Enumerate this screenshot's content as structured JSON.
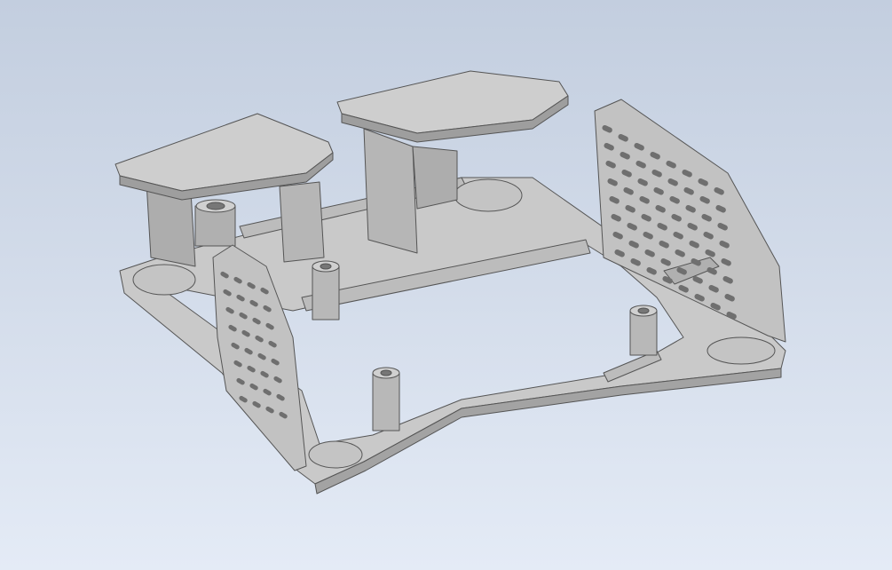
{
  "viewport": {
    "background_top": "#c3cedf",
    "background_bottom": "#e4ebf6"
  },
  "model": {
    "face_color": "#b4b4b4",
    "top_color": "#cdcdcd",
    "edge_color": "#555555",
    "shadow_color": "#8e8e8e",
    "slot_color": "#6f6f6f"
  }
}
